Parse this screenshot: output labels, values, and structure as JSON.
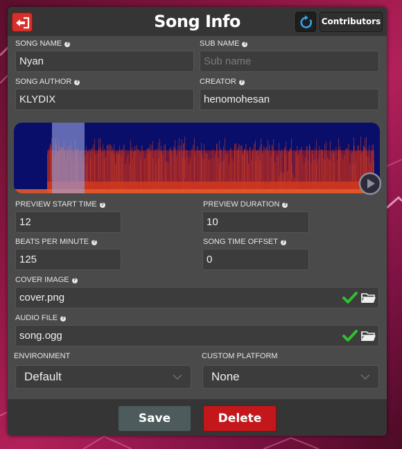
{
  "window": {
    "title": "Song Info"
  },
  "header": {
    "back_icon": "exit-icon",
    "reset_icon": "refresh-icon",
    "contributors_label": "Contributors"
  },
  "fields": {
    "song_name": {
      "label": "SONG NAME",
      "value": "Nyan"
    },
    "sub_name": {
      "label": "SUB NAME",
      "placeholder": "Sub name",
      "value": ""
    },
    "song_author": {
      "label": "SONG AUTHOR",
      "value": "KLYDIX"
    },
    "creator": {
      "label": "CREATOR",
      "value": "henomohesan"
    },
    "preview_start": {
      "label": "PREVIEW START TIME",
      "value": "12"
    },
    "preview_duration": {
      "label": "PREVIEW DURATION",
      "value": "10"
    },
    "bpm": {
      "label": "BEATS PER MINUTE",
      "value": "125"
    },
    "time_offset": {
      "label": "SONG TIME OFFSET",
      "value": "0"
    },
    "cover_image": {
      "label": "COVER IMAGE",
      "value": "cover.png",
      "valid": true
    },
    "audio_file": {
      "label": "AUDIO FILE",
      "value": "song.ogg",
      "valid": true
    }
  },
  "dropdowns": {
    "environment": {
      "label": "ENVIRONMENT",
      "selected": "Default"
    },
    "custom_platform": {
      "label": "CUSTOM PLATFORM",
      "selected": "None"
    }
  },
  "footer": {
    "save_label": "Save",
    "delete_label": "Delete"
  },
  "colors": {
    "accent_red": "#d6302a",
    "delete_red": "#c3171b",
    "save_gray": "#4d5b5d",
    "check_green": "#2fbf2f",
    "spectrogram_bg": "#0a0e6b"
  }
}
